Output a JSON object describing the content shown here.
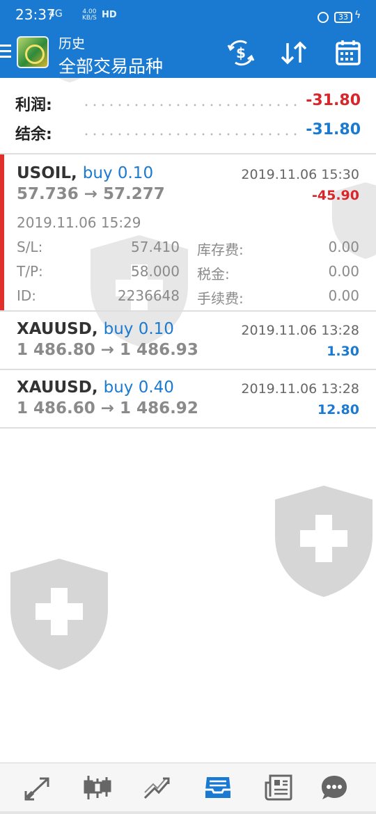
{
  "status_bar": {
    "time": "23:37",
    "signal": "4G",
    "speed_value": "4.00",
    "speed_unit": "KB/S",
    "hd": "HD",
    "battery": "33"
  },
  "header": {
    "title": "历史",
    "subtitle": "全部交易品种",
    "icons": [
      "menu-icon",
      "metatrader-logo",
      "currency-exchange-icon",
      "sort-icon",
      "calendar-icon"
    ]
  },
  "summary": {
    "profit_label": "利润:",
    "profit_value": "-31.80",
    "balance_label": "结余:",
    "balance_value": "-31.80"
  },
  "trades": [
    {
      "symbol": "USOIL,",
      "side": "buy 0.10",
      "prices": "57.736 → 57.277",
      "close_time": "2019.11.06 15:30",
      "profit": "-45.90",
      "open_time": "2019.11.06 15:29",
      "sl_label": "S/L:",
      "sl": "57.410",
      "tp_label": "T/P:",
      "tp": "58.000",
      "id_label": "ID:",
      "id": "2236648",
      "swap_label": "库存费:",
      "swap": "0.00",
      "tax_label": "税金:",
      "tax": "0.00",
      "commission_label": "手续费:",
      "commission": "0.00"
    },
    {
      "symbol": "XAUUSD,",
      "side": "buy 0.10",
      "prices": "1 486.80 → 1 486.93",
      "close_time": "2019.11.06 13:28",
      "profit": "1.30"
    },
    {
      "symbol": "XAUUSD,",
      "side": "buy 0.40",
      "prices": "1 486.60 → 1 486.92",
      "close_time": "2019.11.06 13:28",
      "profit": "12.80"
    }
  ],
  "bottom_nav": [
    "quotes-icon",
    "chart-icon",
    "trade-icon",
    "history-icon",
    "news-icon",
    "chat-icon"
  ],
  "colors": {
    "header_blue": "#1a7ad2",
    "loss_red": "#d8262a",
    "gain_blue": "#1a7ad2"
  }
}
